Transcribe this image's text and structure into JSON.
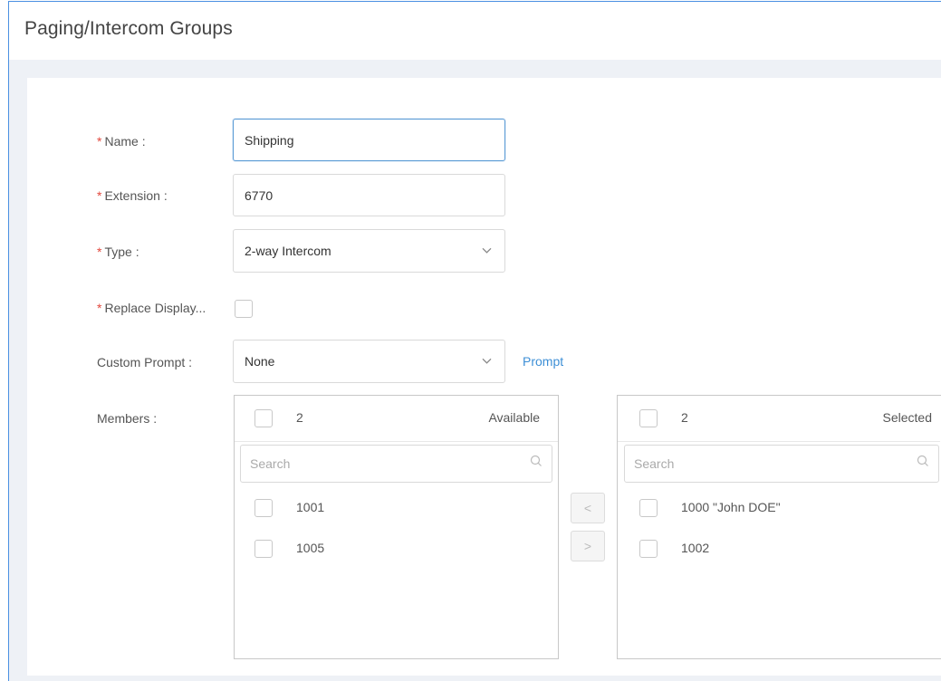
{
  "header": {
    "title": "Paging/Intercom Groups"
  },
  "form": {
    "name": {
      "label": "Name :",
      "value": "Shipping"
    },
    "extension": {
      "label": "Extension :",
      "value": "6770"
    },
    "type": {
      "label": "Type :",
      "value": "2-way Intercom"
    },
    "replace_display": {
      "label": "Replace Display..."
    },
    "custom_prompt": {
      "label": "Custom Prompt :",
      "value": "None",
      "link": "Prompt"
    },
    "members": {
      "label": "Members :"
    }
  },
  "required_mark": "*",
  "available": {
    "count": "2",
    "title": "Available",
    "search_placeholder": "Search",
    "items": [
      "1001",
      "1005"
    ]
  },
  "selected": {
    "count": "2",
    "title": "Selected",
    "search_placeholder": "Search",
    "items": [
      "1000 \"John DOE\"",
      "1002"
    ]
  },
  "transfer": {
    "left_label": "<",
    "right_label": ">"
  },
  "colors": {
    "accent": "#3d8fd6",
    "required": "#e2483d",
    "frame": "#4a90e2"
  },
  "icons": {
    "dropdown": "chevron-down-icon",
    "search": "search-icon"
  }
}
